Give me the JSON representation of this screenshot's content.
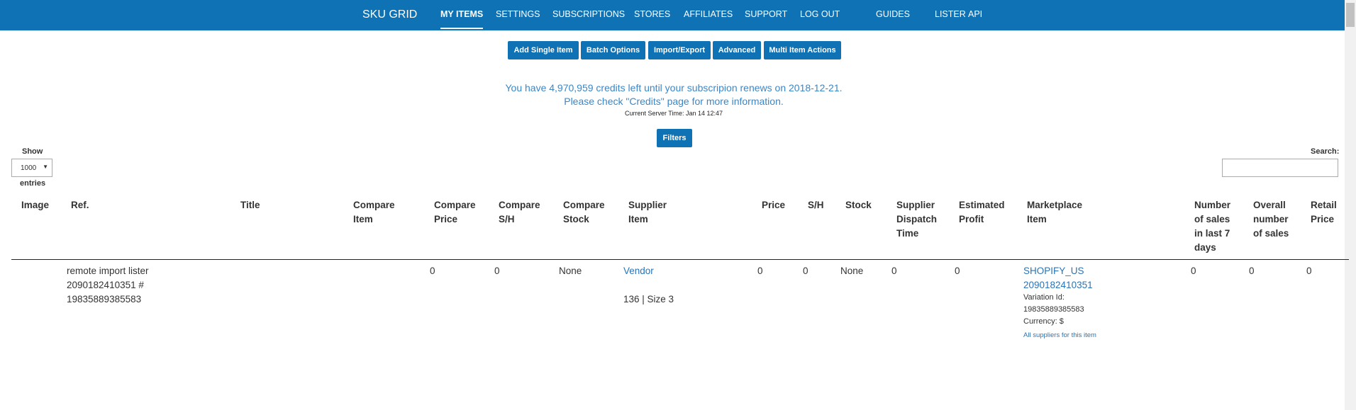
{
  "nav": {
    "brand": "SKU GRID",
    "items": [
      {
        "label": "MY ITEMS"
      },
      {
        "label": "SETTINGS"
      },
      {
        "label": "SUBSCRIPTIONS"
      },
      {
        "label": "STORES"
      },
      {
        "label": "AFFILIATES"
      },
      {
        "label": "SUPPORT"
      },
      {
        "label": "LOG OUT"
      },
      {
        "label": "GUIDES"
      },
      {
        "label": "LISTER"
      },
      {
        "label": "API"
      }
    ]
  },
  "actions": {
    "add_single": "Add Single Item",
    "batch": "Batch Options",
    "import_export": "Import/Export",
    "advanced": "Advanced",
    "multi": "Multi Item Actions"
  },
  "credits": {
    "line1": "You have 4,970,959 credits left until your subscripion renews on 2018-12-21.",
    "line2": "Please check \"Credits\" page for more information.",
    "server_time": "Current Server Time: Jan 14 12:47"
  },
  "filters_label": "Filters",
  "table_controls": {
    "show_label": "Show",
    "page_size": "1000",
    "entries_label": "entries",
    "search_label": "Search:",
    "search_value": ""
  },
  "columns": {
    "image": "Image",
    "ref": "Ref.",
    "title": "Title",
    "compare_item": "Compare Item",
    "compare_price": "Compare Price",
    "compare_sh": "Compare S/H",
    "compare_stock": "Compare Stock",
    "supplier_item": "Supplier Item",
    "price": "Price",
    "sh": "S/H",
    "stock": "Stock",
    "dispatch": "Supplier Dispatch Time",
    "profit": "Estimated Profit",
    "marketplace": "Marketplace Item",
    "sales7": "Number of sales in last 7 days",
    "sales_total": "Overall number of sales",
    "retail": "Retail Price"
  },
  "row": {
    "ref_line1": "remote import lister",
    "ref_line2": "2090182410351 #",
    "ref_line3": "19835889385583",
    "compare_price": "0",
    "compare_sh": "0",
    "compare_stock": "None",
    "supplier_link": "Vendor",
    "supplier_variant": "136 | Size 3",
    "price": "0",
    "sh": "0",
    "stock": "None",
    "dispatch": "0",
    "profit": "0",
    "marketplace_line1": "SHOPIFY_US",
    "marketplace_line2": "2090182410351",
    "variation_label": "Variation Id:",
    "variation_id": "19835889385583",
    "currency": "Currency: $",
    "all_suppliers": "All suppliers for this item",
    "sales7": "0",
    "sales_total": "0",
    "retail": "0"
  }
}
